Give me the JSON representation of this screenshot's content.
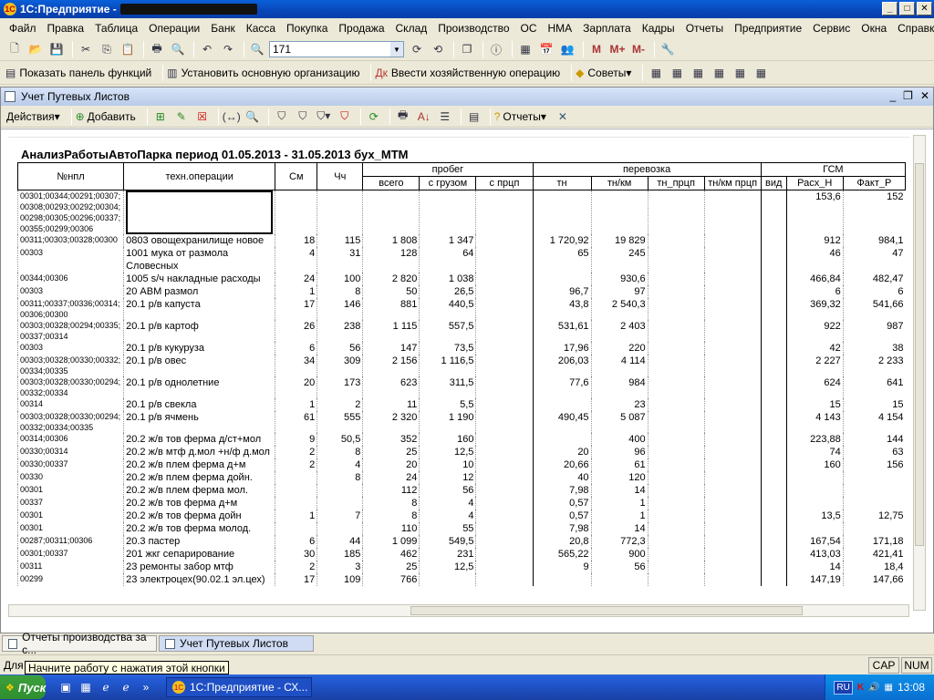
{
  "window": {
    "title": "1С:Предприятие -"
  },
  "menu": [
    "Файл",
    "Правка",
    "Таблица",
    "Операции",
    "Банк",
    "Касса",
    "Покупка",
    "Продажа",
    "Склад",
    "Производство",
    "ОС",
    "НМА",
    "Зарплата",
    "Кадры",
    "Отчеты",
    "Предприятие",
    "Сервис",
    "Окна",
    "Справка"
  ],
  "toolbar1": {
    "search_value": "171"
  },
  "toolbar2": {
    "show_panel": "Показать панель функций",
    "set_org": "Установить основную организацию",
    "enter_op": "Ввести хозяйственную операцию",
    "tips": "Советы"
  },
  "document": {
    "title": "Учет Путевых Листов",
    "actions": "Действия",
    "add": "Добавить",
    "reports": "Отчеты"
  },
  "report": {
    "title": "АнализРаботыАвтоПарка период 01.05.2013 - 31.05.2013 бух_МТМ",
    "headers": {
      "num": "№нпл",
      "ops": "техн.операции",
      "cm": "См",
      "ch": "Чч",
      "probeg": "пробег",
      "vsego": "всего",
      "s_gruzom": "с грузом",
      "s_prcp": "с прцп",
      "perevozka": "перевозка",
      "tn": "тн",
      "tnkm": "тн/км",
      "tn_prcp": "тн_прцп",
      "tnkm_prcp": "тн/км прцп",
      "gsm": "ГСМ",
      "vid": "вид",
      "rash": "Расх_Н",
      "fakt": "Факт_Р"
    },
    "rows": [
      {
        "codes": "00301;00344;00291;00307;00308;00293;00292;00304;00298;00305;00296;00337;00355;00299;00306",
        "op": "",
        "cm": "",
        "ch": "",
        "vsego": "",
        "sgr": "",
        "sprc": "",
        "tn": "",
        "tnkm": "",
        "tnprc": "",
        "tnkmprc": "",
        "vid": "",
        "rash": "153,6",
        "fakt": "152"
      },
      {
        "codes": "00311;00303;00328;00300",
        "op": "0803 овощехранилище новое",
        "cm": "18",
        "ch": "115",
        "vsego": "1 808",
        "sgr": "1 347",
        "sprc": "",
        "tn": "1 720,92",
        "tnkm": "19 829",
        "tnprc": "",
        "tnkmprc": "",
        "vid": "",
        "rash": "912",
        "fakt": "984,1"
      },
      {
        "codes": "00303",
        "op": "1001 мука от размола Словесных",
        "cm": "4",
        "ch": "31",
        "vsego": "128",
        "sgr": "64",
        "sprc": "",
        "tn": "65",
        "tnkm": "245",
        "tnprc": "",
        "tnkmprc": "",
        "vid": "",
        "rash": "46",
        "fakt": "47"
      },
      {
        "codes": "00344;00306",
        "op": "1005 s/ч  накладные расходы",
        "cm": "24",
        "ch": "100",
        "vsego": "2 820",
        "sgr": "1 038",
        "sprc": "",
        "tn": "",
        "tnkm": "930,6",
        "tnprc": "",
        "tnkmprc": "",
        "vid": "",
        "rash": "466,84",
        "fakt": "482,47"
      },
      {
        "codes": "00303",
        "op": "20 АВМ размол",
        "cm": "1",
        "ch": "8",
        "vsego": "50",
        "sgr": "26,5",
        "sprc": "",
        "tn": "96,7",
        "tnkm": "97",
        "tnprc": "",
        "tnkmprc": "",
        "vid": "",
        "rash": "6",
        "fakt": "6"
      },
      {
        "codes": "00311;00337;00336;00314;00306;00300",
        "op": "20.1 р/в капуста",
        "cm": "17",
        "ch": "146",
        "vsego": "881",
        "sgr": "440,5",
        "sprc": "",
        "tn": "43,8",
        "tnkm": "2 540,3",
        "tnprc": "",
        "tnkmprc": "",
        "vid": "",
        "rash": "369,32",
        "fakt": "541,66"
      },
      {
        "codes": "00303;00328;00294;00335;00337;00314",
        "op": "20.1 р/в картоф",
        "cm": "26",
        "ch": "238",
        "vsego": "1 115",
        "sgr": "557,5",
        "sprc": "",
        "tn": "531,61",
        "tnkm": "2 403",
        "tnprc": "",
        "tnkmprc": "",
        "vid": "",
        "rash": "922",
        "fakt": "987"
      },
      {
        "codes": "00303",
        "op": "20.1 р/в кукуруза",
        "cm": "6",
        "ch": "56",
        "vsego": "147",
        "sgr": "73,5",
        "sprc": "",
        "tn": "17,96",
        "tnkm": "220",
        "tnprc": "",
        "tnkmprc": "",
        "vid": "",
        "rash": "42",
        "fakt": "38"
      },
      {
        "codes": "00303;00328;00330;00332;00334;00335",
        "op": "20.1 р/в овес",
        "cm": "34",
        "ch": "309",
        "vsego": "2 156",
        "sgr": "1 116,5",
        "sprc": "",
        "tn": "206,03",
        "tnkm": "4 114",
        "tnprc": "",
        "tnkmprc": "",
        "vid": "",
        "rash": "2 227",
        "fakt": "2 233"
      },
      {
        "codes": "00303;00328;00330;00294;00332;00334",
        "op": "20.1 р/в однолетние",
        "cm": "20",
        "ch": "173",
        "vsego": "623",
        "sgr": "311,5",
        "sprc": "",
        "tn": "77,6",
        "tnkm": "984",
        "tnprc": "",
        "tnkmprc": "",
        "vid": "",
        "rash": "624",
        "fakt": "641"
      },
      {
        "codes": "00314",
        "op": "20.1 р/в свекла",
        "cm": "1",
        "ch": "2",
        "vsego": "11",
        "sgr": "5,5",
        "sprc": "",
        "tn": "",
        "tnkm": "23",
        "tnprc": "",
        "tnkmprc": "",
        "vid": "",
        "rash": "15",
        "fakt": "15"
      },
      {
        "codes": "00303;00328;00330;00294;00332;00334;00335",
        "op": "20.1 р/в ячмень",
        "cm": "61",
        "ch": "555",
        "vsego": "2 320",
        "sgr": "1 190",
        "sprc": "",
        "tn": "490,45",
        "tnkm": "5 087",
        "tnprc": "",
        "tnkmprc": "",
        "vid": "",
        "rash": "4 143",
        "fakt": "4 154"
      },
      {
        "codes": "00314;00306",
        "op": "20.2 ж/в    тов ферма д/ст+мол",
        "cm": "9",
        "ch": "50,5",
        "vsego": "352",
        "sgr": "160",
        "sprc": "",
        "tn": "",
        "tnkm": "400",
        "tnprc": "",
        "tnkmprc": "",
        "vid": "",
        "rash": "223,88",
        "fakt": "144"
      },
      {
        "codes": "00330;00314",
        "op": "20.2 ж/в мтф д.мол +н/ф д.мол",
        "cm": "2",
        "ch": "8",
        "vsego": "25",
        "sgr": "12,5",
        "sprc": "",
        "tn": "20",
        "tnkm": "96",
        "tnprc": "",
        "tnkmprc": "",
        "vid": "",
        "rash": "74",
        "fakt": "63"
      },
      {
        "codes": "00330;00337",
        "op": "20.2 ж/в плем ферма д+м",
        "cm": "2",
        "ch": "4",
        "vsego": "20",
        "sgr": "10",
        "sprc": "",
        "tn": "20,66",
        "tnkm": "61",
        "tnprc": "",
        "tnkmprc": "",
        "vid": "",
        "rash": "160",
        "fakt": "156"
      },
      {
        "codes": "00330",
        "op": "20.2 ж/в плем ферма дойн.",
        "cm": "",
        "ch": "8",
        "vsego": "24",
        "sgr": "12",
        "sprc": "",
        "tn": "40",
        "tnkm": "120",
        "tnprc": "",
        "tnkmprc": "",
        "vid": "",
        "rash": "",
        "fakt": ""
      },
      {
        "codes": "00301",
        "op": "20.2 ж/в плем ферма мол.",
        "cm": "",
        "ch": "",
        "vsego": "112",
        "sgr": "56",
        "sprc": "",
        "tn": "7,98",
        "tnkm": "14",
        "tnprc": "",
        "tnkmprc": "",
        "vid": "",
        "rash": "",
        "fakt": ""
      },
      {
        "codes": "00337",
        "op": "20.2 ж/в тов ферма д+м",
        "cm": "",
        "ch": "",
        "vsego": "8",
        "sgr": "4",
        "sprc": "",
        "tn": "0,57",
        "tnkm": "1",
        "tnprc": "",
        "tnkmprc": "",
        "vid": "",
        "rash": "",
        "fakt": ""
      },
      {
        "codes": "00301",
        "op": "20.2 ж/в тов ферма дойн",
        "cm": "1",
        "ch": "7",
        "vsego": "8",
        "sgr": "4",
        "sprc": "",
        "tn": "0,57",
        "tnkm": "1",
        "tnprc": "",
        "tnkmprc": "",
        "vid": "",
        "rash": "13,5",
        "fakt": "12,75"
      },
      {
        "codes": "00301",
        "op": "20.2 ж/в тов ферма молод.",
        "cm": "",
        "ch": "",
        "vsego": "110",
        "sgr": "55",
        "sprc": "",
        "tn": "7,98",
        "tnkm": "14",
        "tnprc": "",
        "tnkmprc": "",
        "vid": "",
        "rash": "",
        "fakt": ""
      },
      {
        "codes": "00287;00311;00306",
        "op": "20.3 пастер",
        "cm": "6",
        "ch": "44",
        "vsego": "1 099",
        "sgr": "549,5",
        "sprc": "",
        "tn": "20,8",
        "tnkm": "772,3",
        "tnprc": "",
        "tnkmprc": "",
        "vid": "",
        "rash": "167,54",
        "fakt": "171,18"
      },
      {
        "codes": "00301;00337",
        "op": "201 жкг сепарирование",
        "cm": "30",
        "ch": "185",
        "vsego": "462",
        "sgr": "231",
        "sprc": "",
        "tn": "565,22",
        "tnkm": "900",
        "tnprc": "",
        "tnkmprc": "",
        "vid": "",
        "rash": "413,03",
        "fakt": "421,41"
      },
      {
        "codes": "00311",
        "op": "23 ремонты   забор мтф",
        "cm": "2",
        "ch": "3",
        "vsego": "25",
        "sgr": "12,5",
        "sprc": "",
        "tn": "9",
        "tnkm": "56",
        "tnprc": "",
        "tnkmprc": "",
        "vid": "",
        "rash": "14",
        "fakt": "18,4"
      },
      {
        "codes": "00299",
        "op": "23 электроцех(90.02.1 эл.цех)",
        "cm": "17",
        "ch": "109",
        "vsego": "766",
        "sgr": "",
        "sprc": "",
        "tn": "",
        "tnkm": "",
        "tnprc": "",
        "tnkmprc": "",
        "vid": "",
        "rash": "147,19",
        "fakt": "147,66"
      }
    ]
  },
  "tabs": [
    "Отчеты производства за с...",
    "Учет Путевых Листов"
  ],
  "status": {
    "text": "Для",
    "cap": "CAP",
    "num": "NUM",
    "tooltip": "Начните работу с нажатия этой кнопки"
  },
  "taskbar": {
    "start": "Пуск",
    "task": "1С:Предприятие - СХ...",
    "lang": "RU",
    "time": "13:08"
  }
}
